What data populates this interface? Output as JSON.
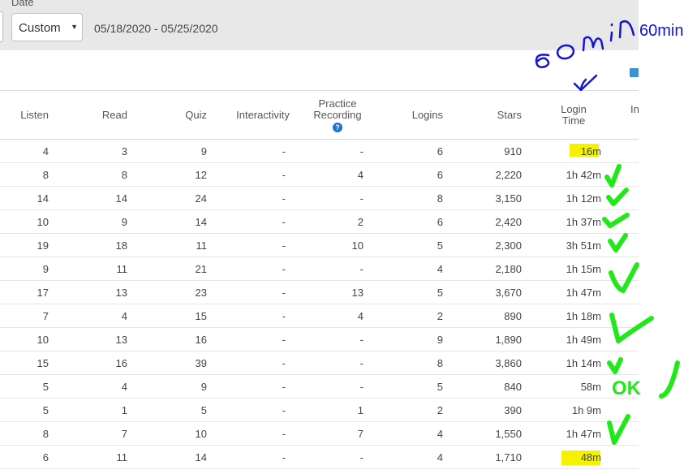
{
  "filter": {
    "label": "Date",
    "select_value": "Custom",
    "date_range": "05/18/2020 - 05/25/2020"
  },
  "columns": {
    "listen": "Listen",
    "read": "Read",
    "quiz": "Quiz",
    "interactivity": "Interactivity",
    "practice_line1": "Practice",
    "practice_line2": "Recording",
    "logins": "Logins",
    "stars": "Stars",
    "login_time_line1": "Login",
    "login_time_line2": "Time",
    "next_partial": "In"
  },
  "icons": {
    "help": "question-circle-icon",
    "export": "export-icon",
    "caret": "chevron-down-icon"
  },
  "rows": [
    {
      "listen": "4",
      "read": "3",
      "quiz": "9",
      "interactivity": "-",
      "practice": "-",
      "logins": "6",
      "stars": "910",
      "login_time": "16m",
      "highlight": true
    },
    {
      "listen": "8",
      "read": "8",
      "quiz": "12",
      "interactivity": "-",
      "practice": "4",
      "logins": "6",
      "stars": "2,220",
      "login_time": "1h 42m"
    },
    {
      "listen": "14",
      "read": "14",
      "quiz": "24",
      "interactivity": "-",
      "practice": "-",
      "logins": "8",
      "stars": "3,150",
      "login_time": "1h 12m"
    },
    {
      "listen": "10",
      "read": "9",
      "quiz": "14",
      "interactivity": "-",
      "practice": "2",
      "logins": "6",
      "stars": "2,420",
      "login_time": "1h 37m"
    },
    {
      "listen": "19",
      "read": "18",
      "quiz": "11",
      "interactivity": "-",
      "practice": "10",
      "logins": "5",
      "stars": "2,300",
      "login_time": "3h 51m"
    },
    {
      "listen": "9",
      "read": "11",
      "quiz": "21",
      "interactivity": "-",
      "practice": "-",
      "logins": "4",
      "stars": "2,180",
      "login_time": "1h 15m"
    },
    {
      "listen": "17",
      "read": "13",
      "quiz": "23",
      "interactivity": "-",
      "practice": "13",
      "logins": "5",
      "stars": "3,670",
      "login_time": "1h 47m"
    },
    {
      "listen": "7",
      "read": "4",
      "quiz": "15",
      "interactivity": "-",
      "practice": "4",
      "logins": "2",
      "stars": "890",
      "login_time": "1h 18m"
    },
    {
      "listen": "10",
      "read": "13",
      "quiz": "16",
      "interactivity": "-",
      "practice": "-",
      "logins": "9",
      "stars": "1,890",
      "login_time": "1h 49m"
    },
    {
      "listen": "15",
      "read": "16",
      "quiz": "39",
      "interactivity": "-",
      "practice": "-",
      "logins": "8",
      "stars": "3,860",
      "login_time": "1h 14m"
    },
    {
      "listen": "5",
      "read": "4",
      "quiz": "9",
      "interactivity": "-",
      "practice": "-",
      "logins": "5",
      "stars": "840",
      "login_time": "58m"
    },
    {
      "listen": "5",
      "read": "1",
      "quiz": "5",
      "interactivity": "-",
      "practice": "1",
      "logins": "2",
      "stars": "390",
      "login_time": "1h 9m"
    },
    {
      "listen": "8",
      "read": "7",
      "quiz": "10",
      "interactivity": "-",
      "practice": "7",
      "logins": "4",
      "stars": "1,550",
      "login_time": "1h 47m"
    },
    {
      "listen": "6",
      "read": "11",
      "quiz": "14",
      "interactivity": "-",
      "practice": "-",
      "logins": "4",
      "stars": "1,710",
      "login_time": "48m",
      "highlight": true
    }
  ],
  "annotations": {
    "top_note": "60min.",
    "ok_note": "OK",
    "colors": {
      "blue_ink": "#1414d4",
      "green_ink": "#22e81a",
      "highlight": "#f5f200"
    }
  }
}
